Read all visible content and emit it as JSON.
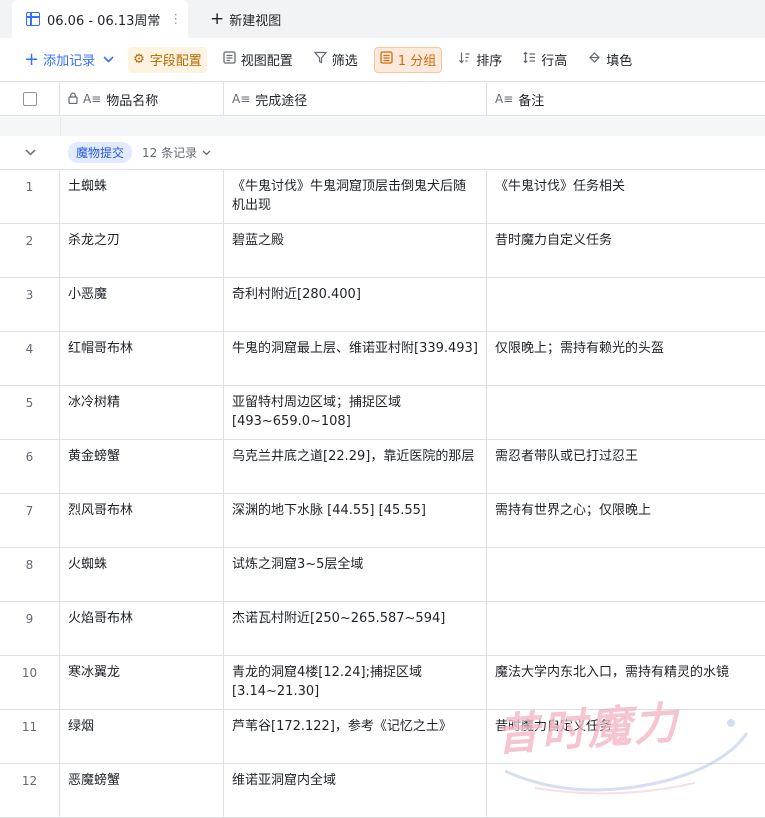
{
  "view_tabs": {
    "active": "06.06 - 06.13周常",
    "more_icon": "⋮",
    "new_view": "新建视图"
  },
  "toolbar": {
    "add_record": "添加记录",
    "field_config": "字段配置",
    "view_config": "视图配置",
    "filter": "筛选",
    "group": "1 分组",
    "sort": "排序",
    "row_height": "行高",
    "fill_color": "填色"
  },
  "columns": {
    "name": "物品名称",
    "route": "完成途径",
    "note": "备注"
  },
  "group": {
    "tag": "魔物提交",
    "count": "12 条记录"
  },
  "rows": [
    {
      "idx": "1",
      "name": "土蜘蛛",
      "route": "《牛鬼讨伐》牛鬼洞窟顶层击倒鬼犬后随机出现",
      "note": "《牛鬼讨伐》任务相关"
    },
    {
      "idx": "2",
      "name": "杀龙之刃",
      "route": "碧蓝之殿",
      "note": "昔时魔力自定义任务"
    },
    {
      "idx": "3",
      "name": "小恶魔",
      "route": "奇利村附近[280.400]",
      "note": ""
    },
    {
      "idx": "4",
      "name": "红帽哥布林",
      "route": "牛鬼的洞窟最上层、维诺亚村附[339.493]",
      "note": "仅限晚上；需持有赖光的头盔"
    },
    {
      "idx": "5",
      "name": "冰冷树精",
      "route": "亚留特村周边区域；捕捉区域[493~659.0~108]",
      "note": ""
    },
    {
      "idx": "6",
      "name": "黄金螃蟹",
      "route": "乌克兰井底之道[22.29]，靠近医院的那层",
      "note": "需忍者带队或已打过忍王"
    },
    {
      "idx": "7",
      "name": "烈风哥布林",
      "route": "深渊的地下水脉 [44.55] [45.55]",
      "note": "需持有世界之心；仅限晚上"
    },
    {
      "idx": "8",
      "name": "火蜘蛛",
      "route": "试炼之洞窟3~5层全域",
      "note": ""
    },
    {
      "idx": "9",
      "name": "火焰哥布林",
      "route": "杰诺瓦村附近[250~265.587~594]",
      "note": ""
    },
    {
      "idx": "10",
      "name": "寒冰翼龙",
      "route": "青龙的洞窟4楼[12.24];捕捉区域[3.14~21.30]",
      "note": "魔法大学内东北入口，需持有精灵的水镜"
    },
    {
      "idx": "11",
      "name": "绿烟",
      "route": "芦苇谷[172.122]，参考《记忆之土》",
      "note": "昔时魔力自定义任务"
    },
    {
      "idx": "12",
      "name": "恶魔螃蟹",
      "route": "维诺亚洞窟内全域",
      "note": ""
    }
  ],
  "watermark": "昔时魔力",
  "colors": {
    "accent": "#3370ff",
    "border": "#dee0e3",
    "group_tag_bg": "#e1eaff"
  }
}
